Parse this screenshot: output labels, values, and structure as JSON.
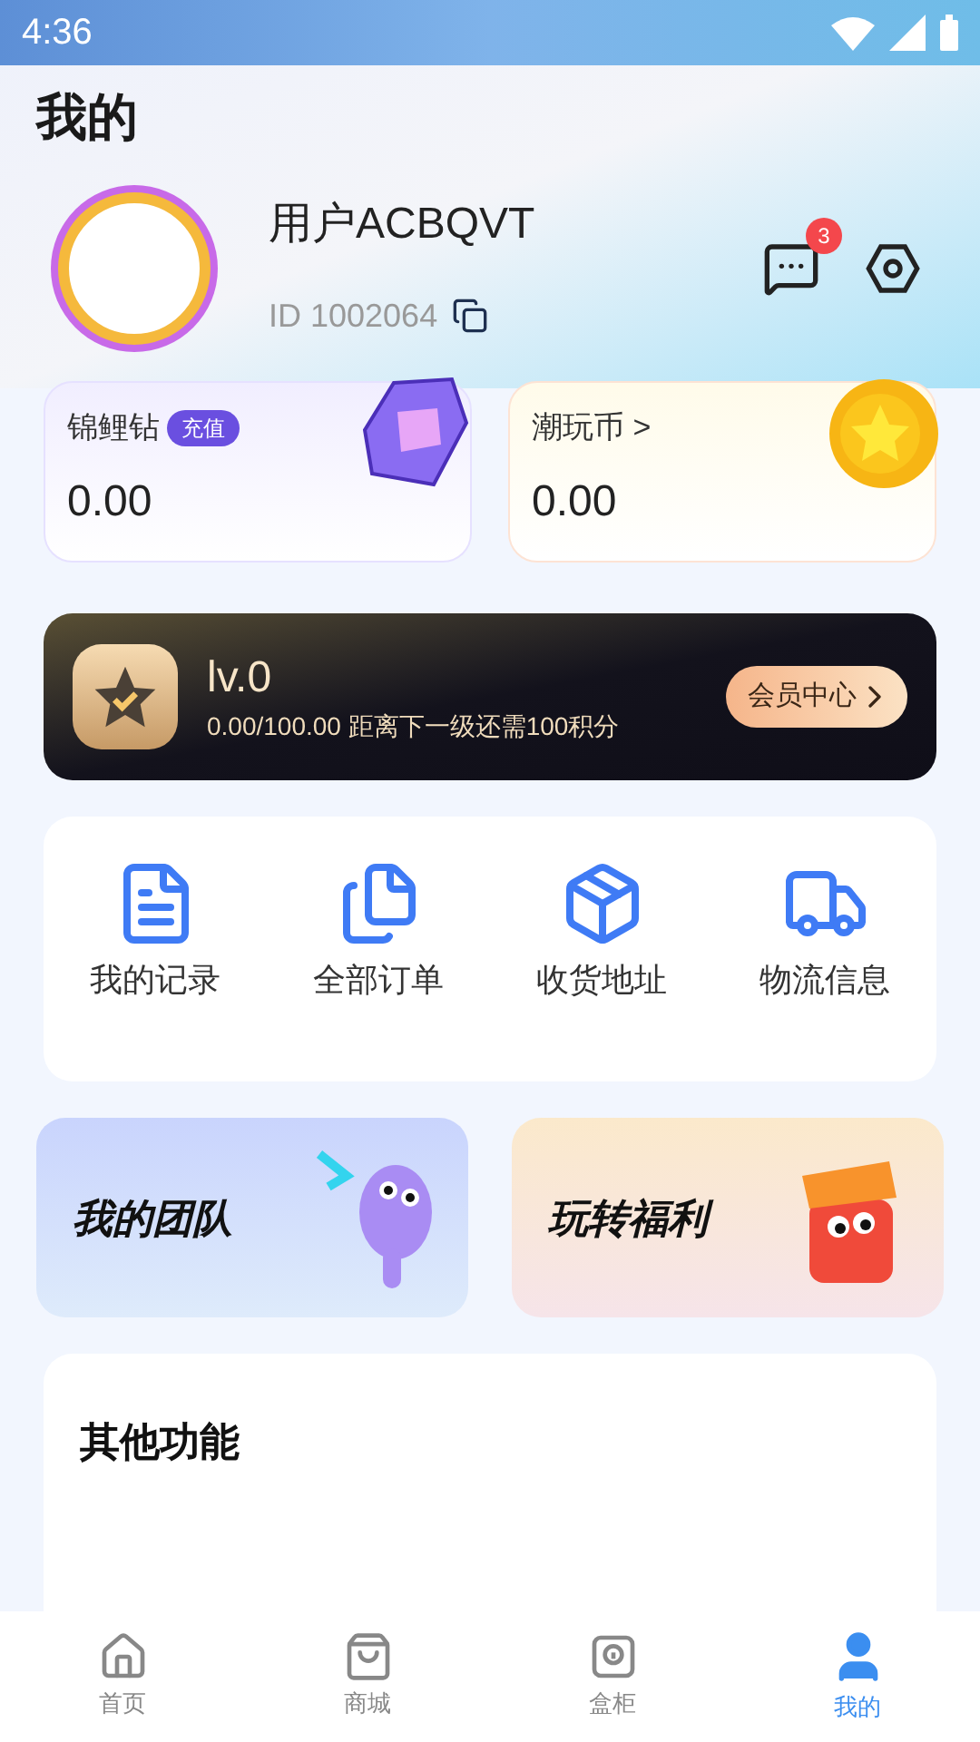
{
  "status_bar": {
    "time": "4:36"
  },
  "header": {
    "title": "我的"
  },
  "profile": {
    "name": "用户ACBQVT",
    "id": "ID 1002064",
    "unread": "3"
  },
  "wallets": [
    {
      "kind": "diamond",
      "label": "锦鲤钻",
      "tag": "充值",
      "value": "0.00"
    },
    {
      "kind": "coin",
      "label": "潮玩币 >",
      "value": "0.00"
    }
  ],
  "membership": {
    "level": "lv.0",
    "progress": "0.00/100.00 距离下一级还需100积分",
    "button": "会员中心"
  },
  "shortcuts": [
    {
      "kind": "records",
      "label": "我的记录"
    },
    {
      "kind": "orders",
      "label": "全部订单"
    },
    {
      "kind": "address",
      "label": "收货地址"
    },
    {
      "kind": "logistics",
      "label": "物流信息"
    }
  ],
  "banners": [
    {
      "kind": "team",
      "label": "我的团队"
    },
    {
      "kind": "welfare",
      "label": "玩转福利"
    }
  ],
  "other": {
    "title": "其他功能"
  },
  "nav": [
    {
      "kind": "home",
      "label": "首页",
      "selected": false
    },
    {
      "kind": "shop",
      "label": "商城",
      "selected": false
    },
    {
      "kind": "cabinet",
      "label": "盒柜",
      "selected": false
    },
    {
      "kind": "me",
      "label": "我的",
      "selected": true
    }
  ]
}
